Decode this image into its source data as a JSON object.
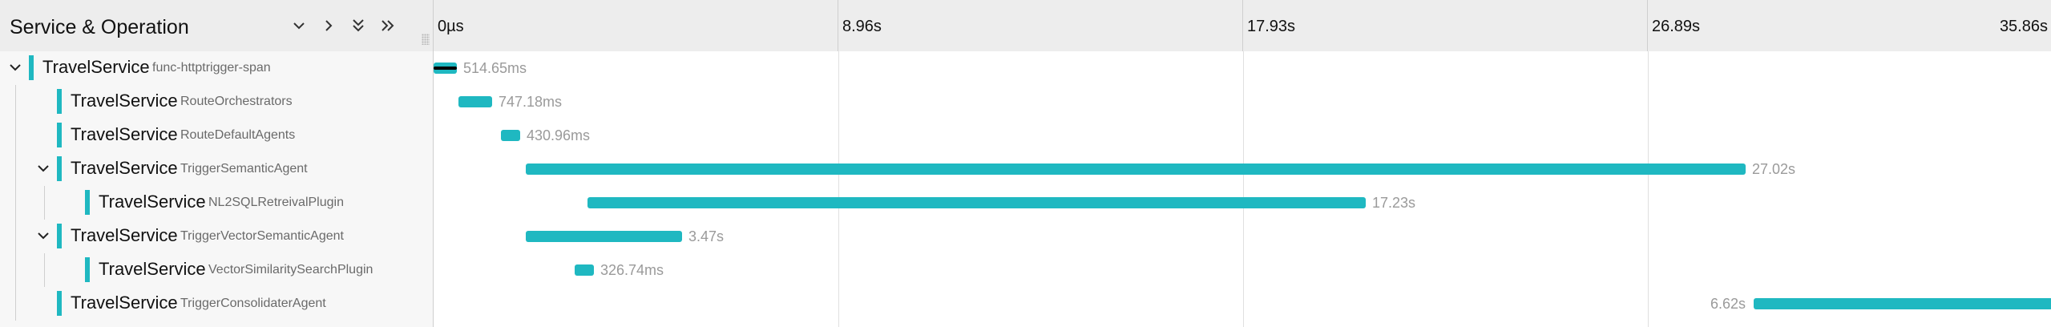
{
  "header": {
    "title": "Service & Operation",
    "ticks": [
      "0µs",
      "8.96s",
      "17.93s",
      "26.89s",
      "35.86s"
    ]
  },
  "colors": {
    "accent": "#1fb8c1",
    "header_bg": "#ededed",
    "list_bg": "#f7f7f7",
    "grid": "#e0e0e0",
    "duration_text": "#9a9a9a",
    "selected_inner": "#000000"
  },
  "trace_total_s": 35.86,
  "spans": [
    {
      "service": "TravelService",
      "operation": "func-httptrigger-span",
      "duration": "514.65ms",
      "start_s": 0.0,
      "duration_s": 0.51465,
      "depth": 0,
      "collapsible": true,
      "selected": true
    },
    {
      "service": "TravelService",
      "operation": "RouteOrchestrators",
      "duration": "747.18ms",
      "start_s": 0.55,
      "duration_s": 0.74718,
      "depth": 1,
      "collapsible": false,
      "selected": false
    },
    {
      "service": "TravelService",
      "operation": "RouteDefaultAgents",
      "duration": "430.96ms",
      "start_s": 1.5,
      "duration_s": 0.43096,
      "depth": 1,
      "collapsible": false,
      "selected": false
    },
    {
      "service": "TravelService",
      "operation": "TriggerSemanticAgent",
      "duration": "27.02s",
      "start_s": 2.05,
      "duration_s": 27.02,
      "depth": 1,
      "collapsible": true,
      "selected": false
    },
    {
      "service": "TravelService",
      "operation": "NL2SQLRetreivalPlugin",
      "duration": "17.23s",
      "start_s": 3.4,
      "duration_s": 17.23,
      "depth": 2,
      "collapsible": false,
      "selected": false
    },
    {
      "service": "TravelService",
      "operation": "TriggerVectorSemanticAgent",
      "duration": "3.47s",
      "start_s": 2.05,
      "duration_s": 3.47,
      "depth": 1,
      "collapsible": true,
      "selected": false
    },
    {
      "service": "TravelService",
      "operation": "VectorSimilaritySearchPlugin",
      "duration": "326.74ms",
      "start_s": 3.12,
      "duration_s": 0.32674,
      "depth": 2,
      "collapsible": false,
      "selected": false
    },
    {
      "service": "TravelService",
      "operation": "TriggerConsolidaterAgent",
      "duration": "6.62s",
      "start_s": 29.24,
      "duration_s": 6.62,
      "depth": 1,
      "collapsible": false,
      "selected": false
    }
  ]
}
